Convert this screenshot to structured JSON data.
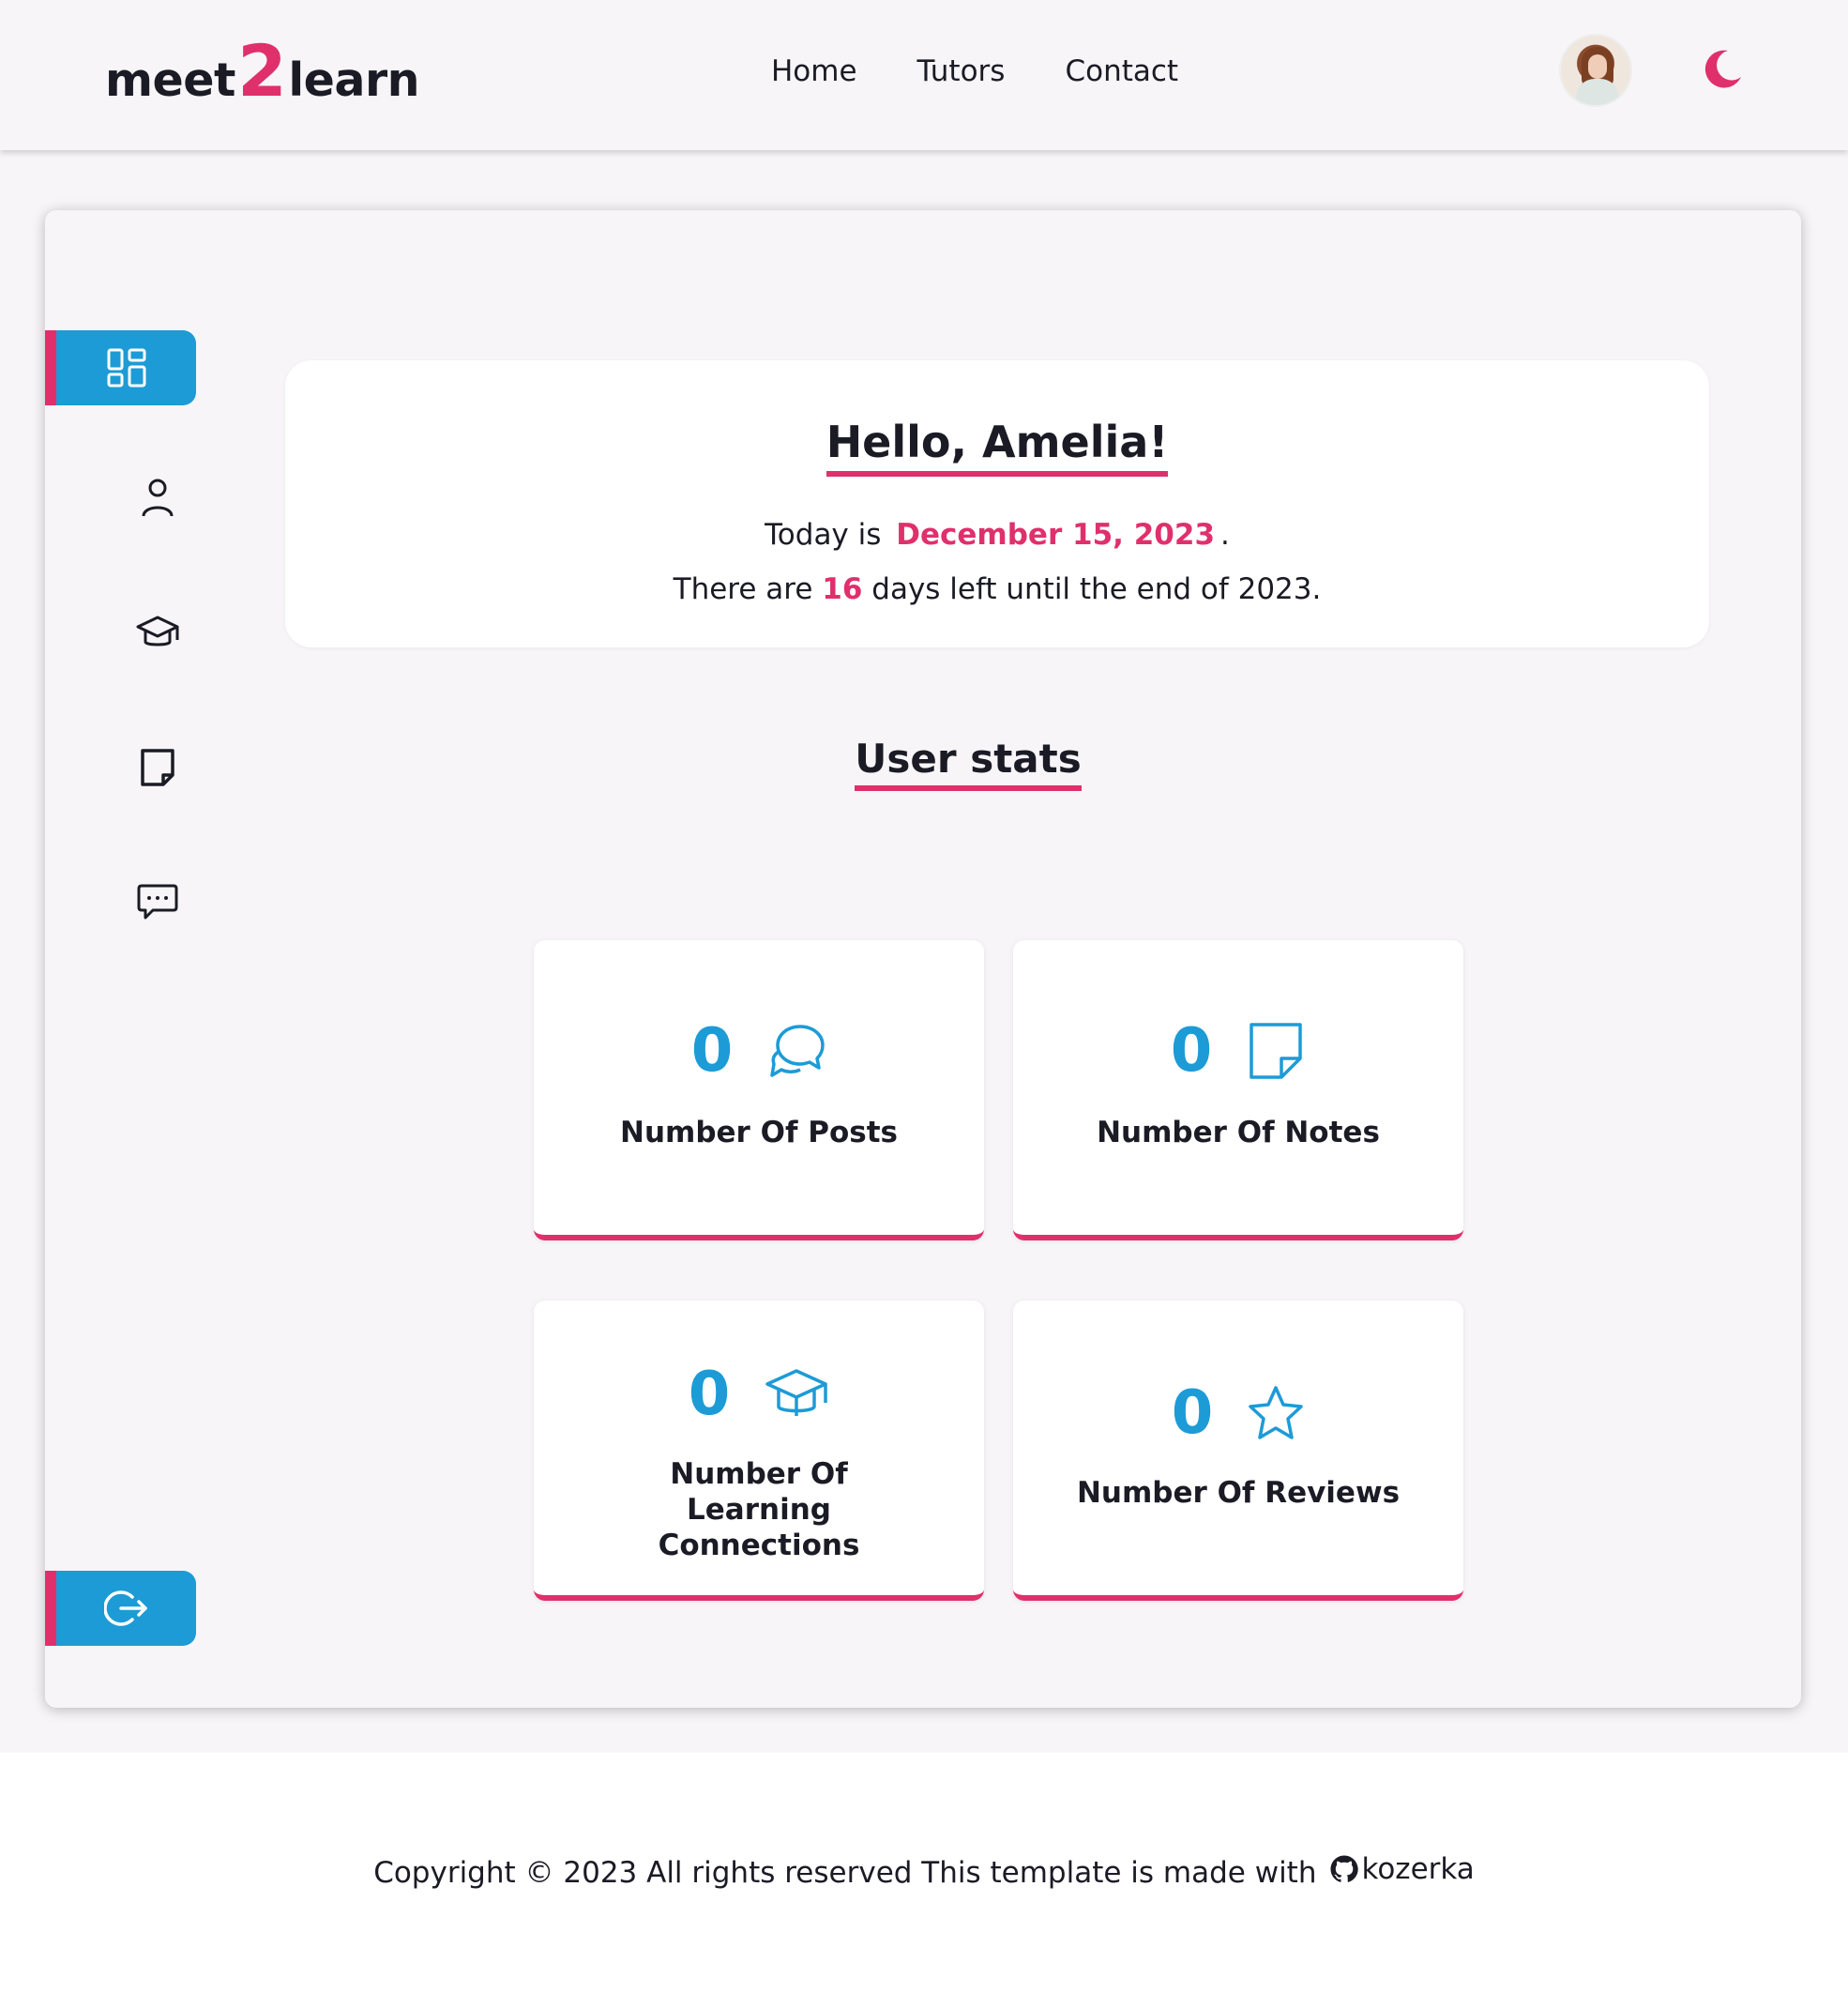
{
  "header": {
    "logo": {
      "part1": "meet",
      "part2": "2",
      "part3": "learn"
    },
    "nav": [
      "Home",
      "Tutors",
      "Contact"
    ]
  },
  "hello": {
    "title": "Hello, Amelia!",
    "today_prefix": "Today is",
    "date": "December 15, 2023",
    "today_suffix": ".",
    "days_prefix": "There are",
    "days_left": "16",
    "days_suffix": "days left until the end of 2023."
  },
  "stats": {
    "title": "User stats",
    "cards": [
      {
        "value": "0",
        "label": "Number Of Posts",
        "icon": "chat-bubbles-icon"
      },
      {
        "value": "0",
        "label": "Number Of Notes",
        "icon": "note-icon"
      },
      {
        "value": "0",
        "label": "Number Of Learning Connections",
        "icon": "graduation-cap-icon"
      },
      {
        "value": "0",
        "label": "Number Of Reviews",
        "icon": "star-icon"
      }
    ]
  },
  "footer": {
    "text": "Copyright © 2023 All rights reserved This template is made with",
    "author": "kozerka"
  },
  "colors": {
    "accent": "#e0306b",
    "primary": "#1d9bd6",
    "text": "#1b1b25"
  }
}
